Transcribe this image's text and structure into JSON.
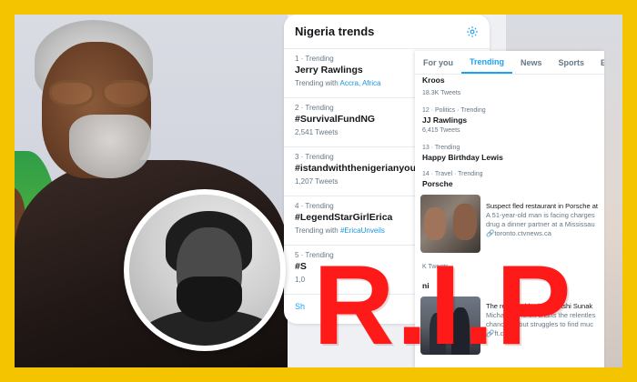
{
  "trends_panel": {
    "title": "Nigeria trends",
    "gear_icon": "gear-icon",
    "items": [
      {
        "meta": "1 · Trending",
        "name": "Jerry Rawlings",
        "sub_prefix": "Trending with ",
        "sub_link": "Accra, Africa"
      },
      {
        "meta": "2 · Trending",
        "name": "#SurvivalFundNG",
        "sub_prefix": "2,541 Tweets",
        "sub_link": ""
      },
      {
        "meta": "3 · Trending",
        "name": "#istandwiththenigerianyouth",
        "sub_prefix": "1,207 Tweets",
        "sub_link": ""
      },
      {
        "meta": "4 · Trending",
        "name": "#LegendStarGirlErica",
        "sub_prefix": "Trending with ",
        "sub_link": "#EricaUnveils"
      },
      {
        "meta": "5 · Trending",
        "name": "#S",
        "sub_prefix": "1,0",
        "sub_link": ""
      }
    ],
    "show_more": "Sh"
  },
  "tabs_panel": {
    "tabs": [
      "For you",
      "Trending",
      "News",
      "Sports",
      "Ent"
    ],
    "active_tab": "Trending",
    "items": [
      {
        "meta": "",
        "name": "Kroos",
        "count": "18.3K Tweets"
      },
      {
        "meta": "12 · Politics · Trending",
        "name": "JJ Rawlings",
        "count": "6,415 Tweets"
      },
      {
        "meta": "13 · Trending",
        "name": "Happy Birthday Lewis",
        "count": ""
      },
      {
        "meta": "14 · Travel · Trending",
        "name": "Porsche",
        "count": ""
      }
    ],
    "news": [
      {
        "title": "Suspect fled restaurant in Porsche at",
        "desc1": "A 51-year-old man is facing charges",
        "desc2": "drug a dinner partner at a Mississau",
        "link": "toronto.ctvnews.ca"
      },
      {
        "title": "The remarkable rise of Rishi Sunak",
        "desc1": "Michael Ashcroft charts the relentles",
        "desc2": "chancellor but struggles to find muc",
        "link": "ft.com"
      }
    ],
    "mid_count": "K Tweets",
    "mid_name": "ni"
  },
  "overlay": {
    "rip_text": "R.I.P",
    "rip_color": "#ff1a1a"
  },
  "frame": {
    "border_color": "#f4c400"
  }
}
